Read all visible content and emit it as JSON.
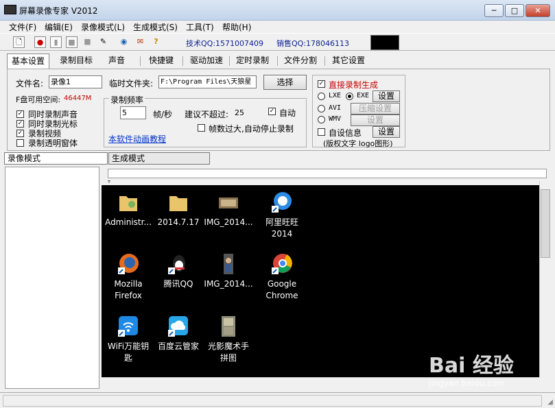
{
  "window": {
    "title": "屏幕录像专家 V2012",
    "controls": {
      "minimize": "─",
      "maximize": "□",
      "close": "✕"
    }
  },
  "menu": [
    "文件(F)",
    "编辑(E)",
    "录像模式(L)",
    "生成模式(S)",
    "工具(T)",
    "帮助(H)"
  ],
  "toolbar": {
    "icons": [
      "new-file-icon",
      "record-icon",
      "pause-icon",
      "stop-icon",
      "camera-icon",
      "pen-icon",
      "globe-icon",
      "gift-icon",
      "help-icon"
    ],
    "tech_qq": "技术QQ:1571007409",
    "sales_qq": "销售QQ:178046113"
  },
  "settings_tabs": [
    "基本设置",
    "录制目标",
    "声音",
    "快捷键",
    "驱动加速",
    "定时录制",
    "文件分割",
    "其它设置"
  ],
  "basic": {
    "file_name_label": "文件名:",
    "file_name_value": "录像1",
    "temp_folder_label": "临时文件夹:",
    "temp_folder_value": "F:\\Program Files\\天狼星",
    "browse_button": "选择",
    "disk_space_label": "F盘可用空间:",
    "disk_space_value": "46447M",
    "checkboxes": [
      {
        "label": "同时录制声音",
        "checked": true
      },
      {
        "label": "同时录制光标",
        "checked": true
      },
      {
        "label": "录制视频",
        "checked": true
      },
      {
        "label": "录制透明窗体",
        "checked": false
      }
    ],
    "frame_rate_title": "录制频率",
    "frame_rate_value": "5",
    "frame_rate_unit": "帧/秒",
    "suggest_label": "建议不超过:",
    "suggest_value": "25",
    "auto_label": "自动",
    "auto_checked": true,
    "auto_stop_label": "帧数过大,自动停止录制",
    "auto_stop_checked": false,
    "tutorial_link": "本软件动画教程"
  },
  "output": {
    "direct_label": "直接录制生成",
    "direct_checked": true,
    "formats": [
      {
        "name": "LXE",
        "selected": false,
        "button": "设置",
        "enabled": true
      },
      {
        "name": "EXE",
        "selected": true
      },
      {
        "name": "AVI",
        "selected": false,
        "button": "压缩设置",
        "enabled": false
      },
      {
        "name": "WMV",
        "selected": false,
        "button": "设置",
        "enabled": false
      }
    ],
    "custom_info_label": "自设信息",
    "custom_info_button": "设置",
    "custom_info_note": "(版权文字 logo图形)"
  },
  "mode_tabs": [
    "录像模式",
    "生成模式"
  ],
  "desktop_icons": [
    {
      "label": "Administr...",
      "icon": "user-folder-icon"
    },
    {
      "label": "2014.7.17",
      "icon": "folder-icon"
    },
    {
      "label": "IMG_2014...",
      "icon": "image-file-icon"
    },
    {
      "label": "阿里旺旺\n2014",
      "icon": "aliwangwang-icon"
    },
    {
      "label": "Mozilla\nFirefox",
      "icon": "firefox-icon"
    },
    {
      "label": "腾讯QQ",
      "icon": "qq-icon"
    },
    {
      "label": "IMG_2014...",
      "icon": "image-file-icon"
    },
    {
      "label": "Google\nChrome",
      "icon": "chrome-icon"
    },
    {
      "label": "WiFi万能钥\n匙",
      "icon": "wifi-key-icon"
    },
    {
      "label": "百度云管家",
      "icon": "baidu-cloud-icon"
    },
    {
      "label": "光影魔术手\n拼图",
      "icon": "photo-tool-icon"
    }
  ],
  "watermark": {
    "text": "Bai 经验",
    "sub": "jingyan.baidu.com"
  }
}
